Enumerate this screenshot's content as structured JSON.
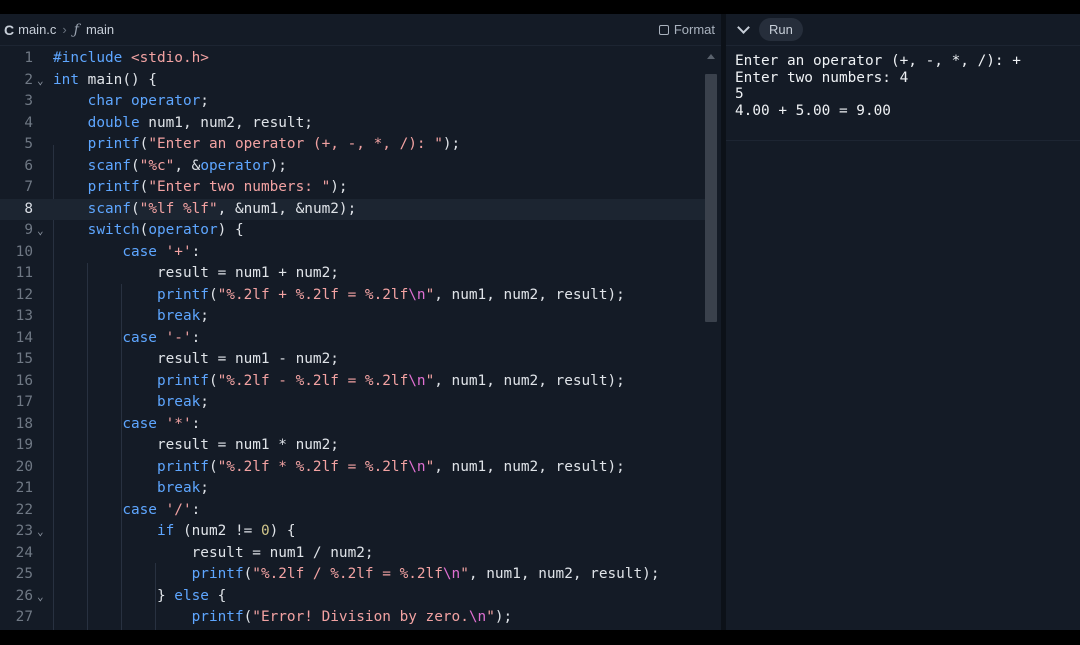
{
  "editor": {
    "breadcrumb": {
      "file": "main.c",
      "separator": "›",
      "function": "main"
    },
    "format_label": "Format",
    "active_line": 8
  },
  "output": {
    "run_label": "Run",
    "console_lines": [
      "Enter an operator (+, -, *, /): +",
      "Enter two numbers: 4",
      "5",
      "4.00 + 5.00 = 9.00"
    ]
  },
  "code_lines": [
    {
      "n": "1",
      "fold": false,
      "text": "#include <stdio.h>"
    },
    {
      "n": "2",
      "fold": true,
      "text": "int main() {"
    },
    {
      "n": "3",
      "fold": false,
      "text": "    char operator;"
    },
    {
      "n": "4",
      "fold": false,
      "text": "    double num1, num2, result;"
    },
    {
      "n": "5",
      "fold": false,
      "text": "    printf(\"Enter an operator (+, -, *, /): \");"
    },
    {
      "n": "6",
      "fold": false,
      "text": "    scanf(\"%c\", &operator);"
    },
    {
      "n": "7",
      "fold": false,
      "text": "    printf(\"Enter two numbers: \");"
    },
    {
      "n": "8",
      "fold": false,
      "text": "    scanf(\"%lf %lf\", &num1, &num2);"
    },
    {
      "n": "9",
      "fold": true,
      "text": "    switch(operator) {"
    },
    {
      "n": "10",
      "fold": false,
      "text": "        case '+':"
    },
    {
      "n": "11",
      "fold": false,
      "text": "            result = num1 + num2;"
    },
    {
      "n": "12",
      "fold": false,
      "text": "            printf(\"%.2lf + %.2lf = %.2lf\\n\", num1, num2, result);"
    },
    {
      "n": "13",
      "fold": false,
      "text": "            break;"
    },
    {
      "n": "14",
      "fold": false,
      "text": "        case '-':"
    },
    {
      "n": "15",
      "fold": false,
      "text": "            result = num1 - num2;"
    },
    {
      "n": "16",
      "fold": false,
      "text": "            printf(\"%.2lf - %.2lf = %.2lf\\n\", num1, num2, result);"
    },
    {
      "n": "17",
      "fold": false,
      "text": "            break;"
    },
    {
      "n": "18",
      "fold": false,
      "text": "        case '*':"
    },
    {
      "n": "19",
      "fold": false,
      "text": "            result = num1 * num2;"
    },
    {
      "n": "20",
      "fold": false,
      "text": "            printf(\"%.2lf * %.2lf = %.2lf\\n\", num1, num2, result);"
    },
    {
      "n": "21",
      "fold": false,
      "text": "            break;"
    },
    {
      "n": "22",
      "fold": false,
      "text": "        case '/':"
    },
    {
      "n": "23",
      "fold": true,
      "text": "            if (num2 != 0) {"
    },
    {
      "n": "24",
      "fold": false,
      "text": "                result = num1 / num2;"
    },
    {
      "n": "25",
      "fold": false,
      "text": "                printf(\"%.2lf / %.2lf = %.2lf\\n\", num1, num2, result);"
    },
    {
      "n": "26",
      "fold": true,
      "text": "            } else {"
    },
    {
      "n": "27",
      "fold": false,
      "text": "                printf(\"Error! Division by zero.\\n\");"
    }
  ]
}
